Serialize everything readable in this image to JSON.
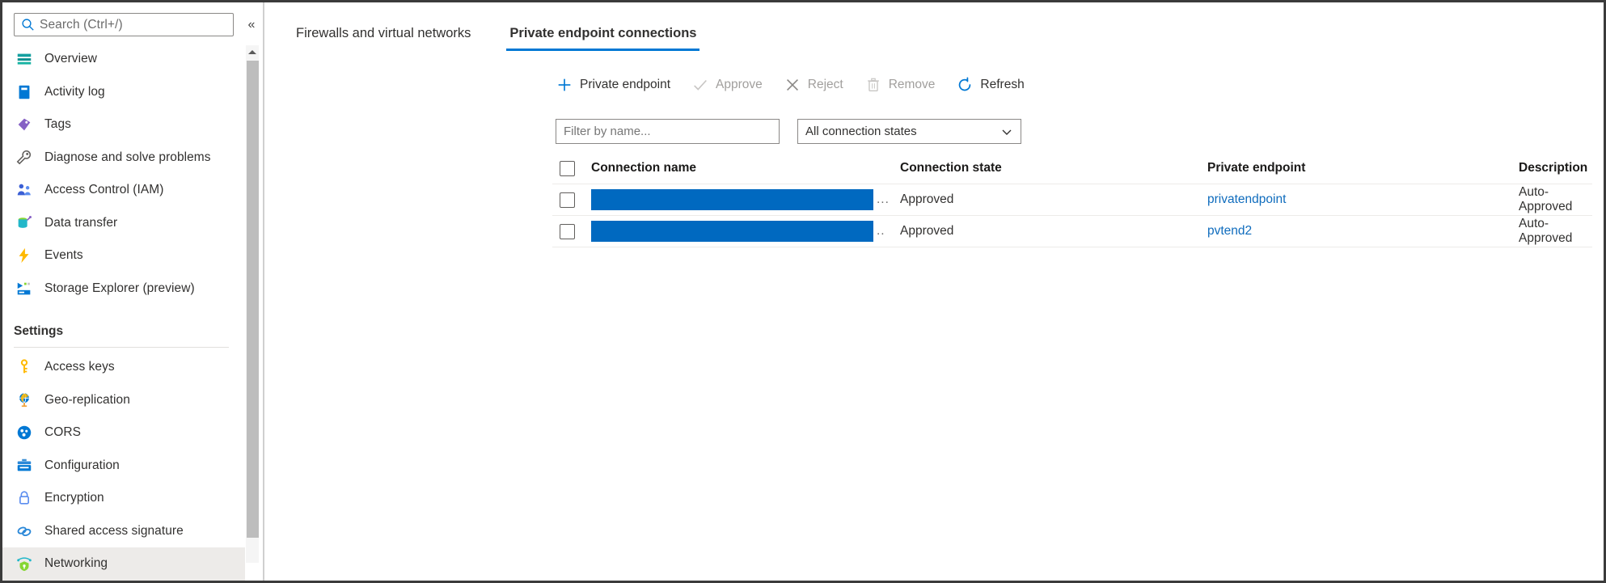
{
  "theme": {
    "accent": "#0078d4",
    "link": "#0f6cbd",
    "redaction": "#0069c0",
    "selected_row_bg": "#edebe9",
    "border": "#8a8886"
  },
  "sidebar": {
    "search": {
      "placeholder": "Search (Ctrl+/)",
      "icon": "search-icon"
    },
    "collapse_label": "«",
    "items": [
      {
        "label": "Overview",
        "icon": "overview-icon",
        "type": "item",
        "selected": false
      },
      {
        "label": "Activity log",
        "icon": "activity-log-icon",
        "type": "item",
        "selected": false
      },
      {
        "label": "Tags",
        "icon": "tags-icon",
        "type": "item",
        "selected": false
      },
      {
        "label": "Diagnose and solve problems",
        "icon": "wrench-icon",
        "type": "item",
        "selected": false
      },
      {
        "label": "Access Control (IAM)",
        "icon": "access-control-icon",
        "type": "item",
        "selected": false
      },
      {
        "label": "Data transfer",
        "icon": "data-transfer-icon",
        "type": "item",
        "selected": false
      },
      {
        "label": "Events",
        "icon": "events-bolt-icon",
        "type": "item",
        "selected": false
      },
      {
        "label": "Storage Explorer (preview)",
        "icon": "storage-explorer-icon",
        "type": "item",
        "selected": false
      },
      {
        "label": "Settings",
        "type": "group"
      },
      {
        "label": "Access keys",
        "icon": "key-icon",
        "type": "item",
        "selected": false
      },
      {
        "label": "Geo-replication",
        "icon": "globe-icon",
        "type": "item",
        "selected": false
      },
      {
        "label": "CORS",
        "icon": "cors-icon",
        "type": "item",
        "selected": false
      },
      {
        "label": "Configuration",
        "icon": "configuration-icon",
        "type": "item",
        "selected": false
      },
      {
        "label": "Encryption",
        "icon": "lock-icon",
        "type": "item",
        "selected": false
      },
      {
        "label": "Shared access signature",
        "icon": "link-chain-icon",
        "type": "item",
        "selected": false
      },
      {
        "label": "Networking",
        "icon": "networking-icon",
        "type": "item",
        "selected": true
      }
    ]
  },
  "main": {
    "tabs": [
      {
        "label": "Firewalls and virtual networks",
        "active": false
      },
      {
        "label": "Private endpoint connections",
        "active": true
      }
    ],
    "toolbar": [
      {
        "label": "Private endpoint",
        "icon": "plus-icon",
        "disabled": false
      },
      {
        "label": "Approve",
        "icon": "checkmark-icon",
        "disabled": true
      },
      {
        "label": "Reject",
        "icon": "cross-icon",
        "disabled": true
      },
      {
        "label": "Remove",
        "icon": "trash-icon",
        "disabled": true
      },
      {
        "label": "Refresh",
        "icon": "refresh-icon",
        "disabled": false
      }
    ],
    "filters": {
      "name_filter_placeholder": "Filter by name...",
      "state_filter_value": "All connection states",
      "chevron": "chevron-down-icon"
    },
    "table": {
      "columns": [
        "Connection name",
        "Connection state",
        "Private endpoint",
        "Description"
      ],
      "rows": [
        {
          "connection_name": "",
          "connection_name_redacted": true,
          "connection_name_suffix": "...",
          "connection_state": "Approved",
          "private_endpoint": "privatendpoint",
          "description": "Auto-Approved"
        },
        {
          "connection_name": "",
          "connection_name_redacted": true,
          "connection_name_suffix": "..",
          "connection_state": "Approved",
          "private_endpoint": "pvtend2",
          "description": "Auto-Approved"
        }
      ]
    }
  }
}
